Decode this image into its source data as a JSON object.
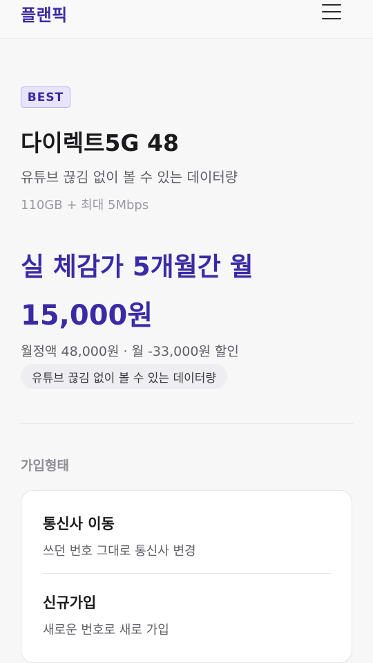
{
  "header": {
    "logo": "플랜픽",
    "menu_icon": "hamburger-menu-icon"
  },
  "plan": {
    "badge": "BEST",
    "title": "다이렉트5G 48",
    "description": "유튜브 끊김 없이 볼 수 있는 데이터량",
    "spec": "110GB + 최대 5Mbps",
    "promo_line1": "실 체감가 5개월간 월",
    "promo_line2": "15,000원",
    "price_detail": "월정액 48,000원 · 월 -33,000원 할인",
    "chip": "유튜브 끊김 없이 볼 수 있는 데이터량"
  },
  "join_type": {
    "label": "가입형태",
    "options": [
      {
        "title": "통신사 이동",
        "subtitle": "쓰던 번호 그대로 통신사 변경"
      },
      {
        "title": "신규가입",
        "subtitle": "새로운 번호로 새로 가입"
      }
    ]
  },
  "colors": {
    "brand": "#3b2aa6",
    "badge_bg": "#e7e4fb",
    "background": "#f7f7f8"
  }
}
